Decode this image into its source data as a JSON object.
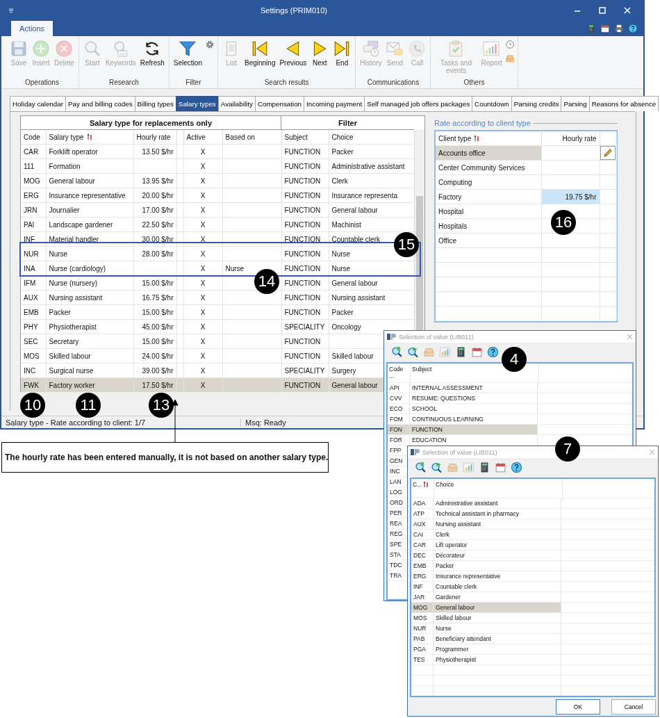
{
  "window": {
    "title": "Settings (PRIM010)"
  },
  "ribbon": {
    "tabs": [
      {
        "label": "Actions",
        "selected": true
      }
    ],
    "groups": [
      {
        "label": "Operations",
        "buttons": [
          {
            "label": "Save",
            "disabled": true
          },
          {
            "label": "Insert",
            "disabled": true
          },
          {
            "label": "Delete",
            "disabled": true
          }
        ]
      },
      {
        "label": "Research",
        "buttons": [
          {
            "label": "Start",
            "disabled": true
          },
          {
            "label": "Keywords",
            "disabled": true
          },
          {
            "label": "Refresh",
            "disabled": false
          }
        ]
      },
      {
        "label": "Filter",
        "buttons": [
          {
            "label": "Selection",
            "disabled": false
          }
        ]
      },
      {
        "label": "Search results",
        "buttons": [
          {
            "label": "List",
            "disabled": true
          },
          {
            "label": "Beginning",
            "disabled": false
          },
          {
            "label": "Previous",
            "disabled": false
          },
          {
            "label": "Next",
            "disabled": false
          },
          {
            "label": "End",
            "disabled": false
          }
        ]
      },
      {
        "label": "Communications",
        "buttons": [
          {
            "label": "History",
            "disabled": true
          },
          {
            "label": "Send",
            "disabled": true
          },
          {
            "label": "Call",
            "disabled": true
          }
        ]
      },
      {
        "label": "Others",
        "buttons": [
          {
            "label": "Tasks and events",
            "disabled": true
          },
          {
            "label": "Report",
            "disabled": true
          }
        ]
      }
    ]
  },
  "tabs": [
    {
      "label": "Holiday calendar",
      "selected": false
    },
    {
      "label": "Pay and billing codes",
      "selected": false
    },
    {
      "label": "Billing types",
      "selected": false
    },
    {
      "label": "Salary types",
      "selected": true
    },
    {
      "label": "Availability",
      "selected": false
    },
    {
      "label": "Compensation",
      "selected": false
    },
    {
      "label": "Incoming payment",
      "selected": false
    },
    {
      "label": "Self managed job offers packages",
      "selected": false
    },
    {
      "label": "Countdown",
      "selected": false
    },
    {
      "label": "Parsing credits",
      "selected": false
    },
    {
      "label": "Parsing",
      "selected": false
    },
    {
      "label": "Reasons for absence",
      "selected": false
    }
  ],
  "table": {
    "column_groups": [
      {
        "label": "Salary type for replacements only"
      },
      {
        "label": "Filter"
      }
    ],
    "columns": [
      {
        "kind": "text",
        "label": "Code",
        "sorted": false
      },
      {
        "kind": "text",
        "label": "Salary type",
        "sorted": true
      },
      {
        "kind": "text",
        "label": "Hourly rate",
        "sorted": false
      },
      {
        "kind": "spacer"
      },
      {
        "kind": "text",
        "label": "Active",
        "sorted": false
      },
      {
        "kind": "text",
        "label": "Based on",
        "sorted": false
      },
      {
        "kind": "text",
        "label": "Subject",
        "sorted": false
      },
      {
        "kind": "text",
        "label": "Choice",
        "sorted": false
      }
    ],
    "rows": [
      {
        "code": "CAR",
        "salary_type": "Forklift operator",
        "hourly_rate": "13.50 $/hr",
        "active": "X",
        "subject": "FUNCTION",
        "choice": "Packer",
        "selected": false
      },
      {
        "code": "111",
        "salary_type": "Formation",
        "active": "X",
        "subject": "FUNCTION",
        "choice": "Administrative assistant",
        "selected": false
      },
      {
        "code": "MOG",
        "salary_type": "General labour",
        "hourly_rate": "13.95 $/hr",
        "active": "X",
        "subject": "FUNCTION",
        "choice": "Clerk",
        "selected": false
      },
      {
        "code": "ERG",
        "salary_type": "Insurance representative",
        "hourly_rate": "20.00 $/hr",
        "active": "X",
        "subject": "FUNCTION",
        "choice": "Insurance representa",
        "selected": false
      },
      {
        "code": "JRN",
        "salary_type": "Journalier",
        "hourly_rate": "17.00 $/hr",
        "active": "X",
        "subject": "FUNCTION",
        "choice": "General labour",
        "selected": false
      },
      {
        "code": "PAI",
        "salary_type": "Landscape gardener",
        "hourly_rate": "22.50 $/hr",
        "active": "X",
        "subject": "FUNCTION",
        "choice": "Machinist",
        "selected": false
      },
      {
        "code": "INF",
        "salary_type": "Material handler",
        "hourly_rate": "30.00 $/hr",
        "active": "X",
        "subject": "FUNCTION",
        "choice": "Countable clerk",
        "selected": false
      },
      {
        "code": "NUR",
        "salary_type": "Nurse",
        "hourly_rate": "28.00 $/hr",
        "active": "X",
        "subject": "FUNCTION",
        "choice": "Nurse",
        "selected": false
      },
      {
        "code": "INA",
        "salary_type": "Nurse (cardiology)",
        "active": "X",
        "based_on": "Nurse",
        "subject": "FUNCTION",
        "choice": "Nurse",
        "selected": false
      },
      {
        "code": "IFM",
        "salary_type": "Nurse (nursery)",
        "hourly_rate": "15.00 $/hr",
        "active": "X",
        "subject": "FUNCTION",
        "choice": "General labour",
        "selected": false
      },
      {
        "code": "AUX",
        "salary_type": "Nursing assistant",
        "hourly_rate": "16.75 $/hr",
        "active": "X",
        "subject": "FUNCTION",
        "choice": "Nursing assistant",
        "selected": false
      },
      {
        "code": "EMB",
        "salary_type": "Packer",
        "hourly_rate": "15.00 $/hr",
        "active": "X",
        "subject": "FUNCTION",
        "choice": "Packer",
        "selected": false
      },
      {
        "code": "PHY",
        "salary_type": "Physiotherapist",
        "hourly_rate": "45.00 $/hr",
        "active": "X",
        "subject": "SPECIALITY",
        "choice": "Oncology",
        "selected": false
      },
      {
        "code": "SEC",
        "salary_type": "Secretary",
        "hourly_rate": "15.00 $/hr",
        "active": "X",
        "subject": "FUNCTION",
        "selected": false
      },
      {
        "code": "MOS",
        "salary_type": "Skilled labour",
        "hourly_rate": "24.00 $/hr",
        "active": "X",
        "subject": "FUNCTION",
        "choice": "Skilled labour",
        "selected": false
      },
      {
        "code": "INC",
        "salary_type": "Surgical nurse",
        "hourly_rate": "39.00 $/hr",
        "active": "X",
        "subject": "SPECIALITY",
        "choice": "Surgery",
        "selected": false
      },
      {
        "code": "FWK",
        "salary_type": "Factory worker",
        "hourly_rate": "17.50 $/hr",
        "active": "X",
        "subject": "FUNCTION",
        "choice": "General labour",
        "selected": true
      }
    ]
  },
  "client_rates": {
    "title": "Rate according to client type",
    "columns": [
      {
        "label": "Client type",
        "sorted": true
      },
      {
        "label": "Hourly rate",
        "sorted": false
      }
    ],
    "rows": [
      {
        "client_type": "Accounts office",
        "selected": true,
        "rate_focused": false,
        "edit_button": true
      },
      {
        "client_type": "Center Community Services",
        "selected": false,
        "rate_focused": false,
        "edit_button": false
      },
      {
        "client_type": "Computing",
        "selected": false,
        "rate_focused": false,
        "edit_button": false
      },
      {
        "client_type": "Factory",
        "hourly_rate": "19.75 $/hr",
        "selected": false,
        "rate_focused": true,
        "edit_button": false
      },
      {
        "client_type": "Hospital",
        "selected": false,
        "rate_focused": false,
        "edit_button": false
      },
      {
        "client_type": "Hospitals",
        "selected": false,
        "rate_focused": false,
        "edit_button": false
      },
      {
        "client_type": "Office",
        "selected": false,
        "rate_focused": false,
        "edit_button": false
      }
    ]
  },
  "status_bar": {
    "left": "Salary type - Rate according to client: 1/7",
    "right": "Msq: Ready"
  },
  "note": "The hourly rate has been entered manually, it is not based on another salary type.",
  "callouts": [
    {
      "label": "10"
    },
    {
      "label": "11"
    },
    {
      "label": "13"
    },
    {
      "label": "14"
    },
    {
      "label": "15"
    },
    {
      "label": "16"
    },
    {
      "label": "4"
    },
    {
      "label": "7"
    }
  ],
  "dialogs": [
    {
      "title": "Selection of value (LIB011)",
      "columns": [
        {
          "label": "Code ...",
          "sorted": false
        },
        {
          "label": "Subject",
          "sorted": false
        }
      ],
      "rows": [
        {
          "code": "API",
          "value": "INTERNAL ASSESSMENT",
          "selected": false
        },
        {
          "code": "CVV",
          "value": "RESUME: QUESTIONS",
          "selected": false
        },
        {
          "code": "ECO",
          "value": "SCHOOL",
          "selected": false
        },
        {
          "code": "FOM",
          "value": "CONTINUOUS LEARNING",
          "selected": false
        },
        {
          "code": "FON",
          "value": "FUNCTION",
          "selected": true
        },
        {
          "code": "FOR",
          "value": "EDUCATION",
          "selected": false
        },
        {
          "code": "FPP",
          "selected": false
        },
        {
          "code": "GEN",
          "selected": false
        },
        {
          "code": "INC",
          "selected": false
        },
        {
          "code": "LAN",
          "selected": false
        },
        {
          "code": "LOG",
          "selected": false
        },
        {
          "code": "ORD",
          "selected": false
        },
        {
          "code": "PER",
          "selected": false
        },
        {
          "code": "REA",
          "selected": false
        },
        {
          "code": "REG",
          "selected": false
        },
        {
          "code": "SPE",
          "selected": false
        },
        {
          "code": "STA",
          "selected": false
        },
        {
          "code": "TDC",
          "selected": false
        },
        {
          "code": "TRA",
          "selected": false
        }
      ]
    },
    {
      "title": "Selection of value (LIB011)",
      "columns": [
        {
          "label": "C...",
          "sorted": true
        },
        {
          "label": "Choice",
          "sorted": false
        }
      ],
      "rows": [
        {
          "code": "ADA",
          "value": "Administrative assistant",
          "selected": false
        },
        {
          "code": "ATP",
          "value": "Technical assistant in pharmacy",
          "selected": false
        },
        {
          "code": "AUX",
          "value": "Nursing assistant",
          "selected": false
        },
        {
          "code": "CAI",
          "value": "Clerk",
          "selected": false
        },
        {
          "code": "CAR",
          "value": "Lift operator",
          "selected": false
        },
        {
          "code": "DEC",
          "value": "Décorateur",
          "selected": false
        },
        {
          "code": "EMB",
          "value": "Packer",
          "selected": false
        },
        {
          "code": "ERG",
          "value": "Insurance representative",
          "selected": false
        },
        {
          "code": "INF",
          "value": "Countable clerk",
          "selected": false
        },
        {
          "code": "JAR",
          "value": "Gardener",
          "selected": false
        },
        {
          "code": "MOG",
          "value": "General labour",
          "selected": true
        },
        {
          "code": "MOS",
          "value": "Skilled labour",
          "selected": false
        },
        {
          "code": "NUR",
          "value": "Nurse",
          "selected": false
        },
        {
          "code": "PAB",
          "value": "Beneficiary attendant",
          "selected": false
        },
        {
          "code": "PGA",
          "value": "Programmer",
          "selected": false
        },
        {
          "code": "TES",
          "value": "Physiotherapist",
          "selected": false
        }
      ],
      "buttons": [
        {
          "label": "OK"
        },
        {
          "label": "Cancel"
        }
      ]
    }
  ]
}
